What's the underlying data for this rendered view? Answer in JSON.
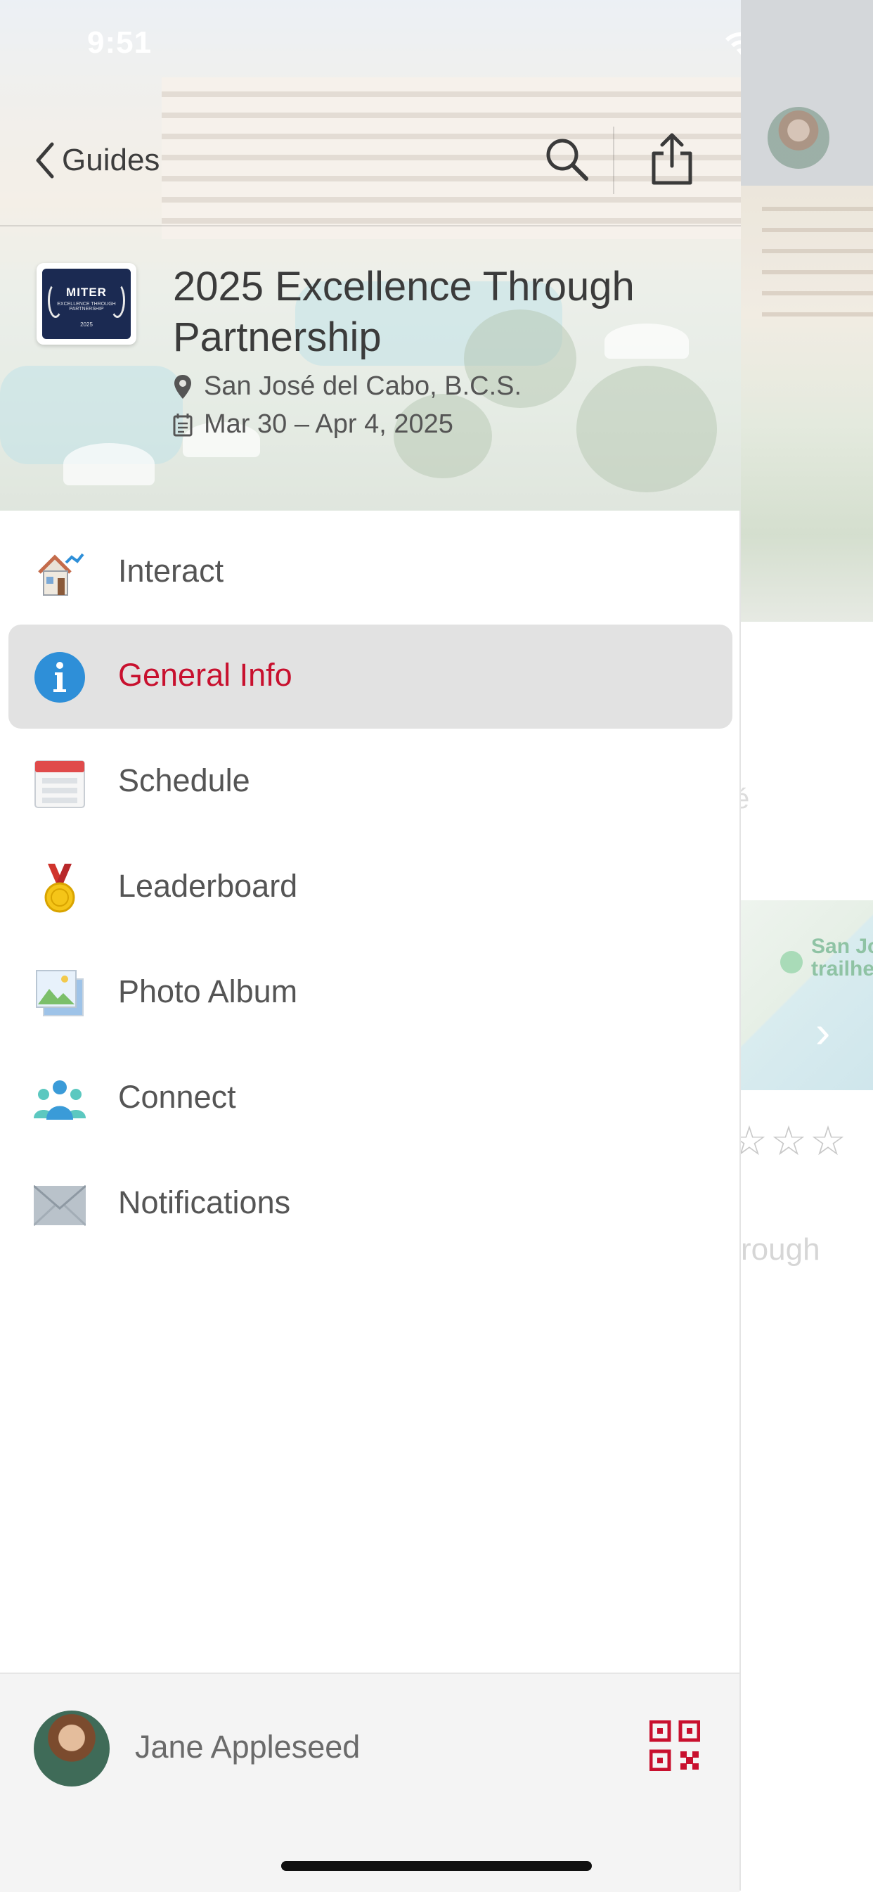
{
  "status_bar": {
    "time": "9:51"
  },
  "nav": {
    "back_label": "Guides"
  },
  "event": {
    "logo_brand": "MITER",
    "logo_subtitle": "EXCELLENCE THROUGH PARTNERSHIP",
    "logo_year": "2025",
    "title": "2025 Excellence Through Partnership",
    "location": "San José del Cabo, B.C.S.",
    "dates": "Mar 30 – Apr 4, 2025"
  },
  "menu": {
    "items": [
      {
        "label": "Interact",
        "icon": "house-icon"
      },
      {
        "label": "General Info",
        "icon": "info-icon",
        "active": true
      },
      {
        "label": "Schedule",
        "icon": "calendar-icon"
      },
      {
        "label": "Leaderboard",
        "icon": "medal-icon"
      },
      {
        "label": "Photo Album",
        "icon": "photo-icon"
      },
      {
        "label": "Connect",
        "icon": "people-icon"
      },
      {
        "label": "Notifications",
        "icon": "envelope-icon"
      }
    ]
  },
  "footer": {
    "user_name": "Jane Appleseed"
  },
  "background": {
    "map_label": "San Jo\ntrailhe",
    "text_fragment": "rough",
    "glyph": "é",
    "rating_stars": "☆☆☆"
  },
  "colors": {
    "accent": "#c8102e",
    "active_bg": "#e2e2e2",
    "text": "#555555",
    "info_blue": "#2e8fd8"
  }
}
